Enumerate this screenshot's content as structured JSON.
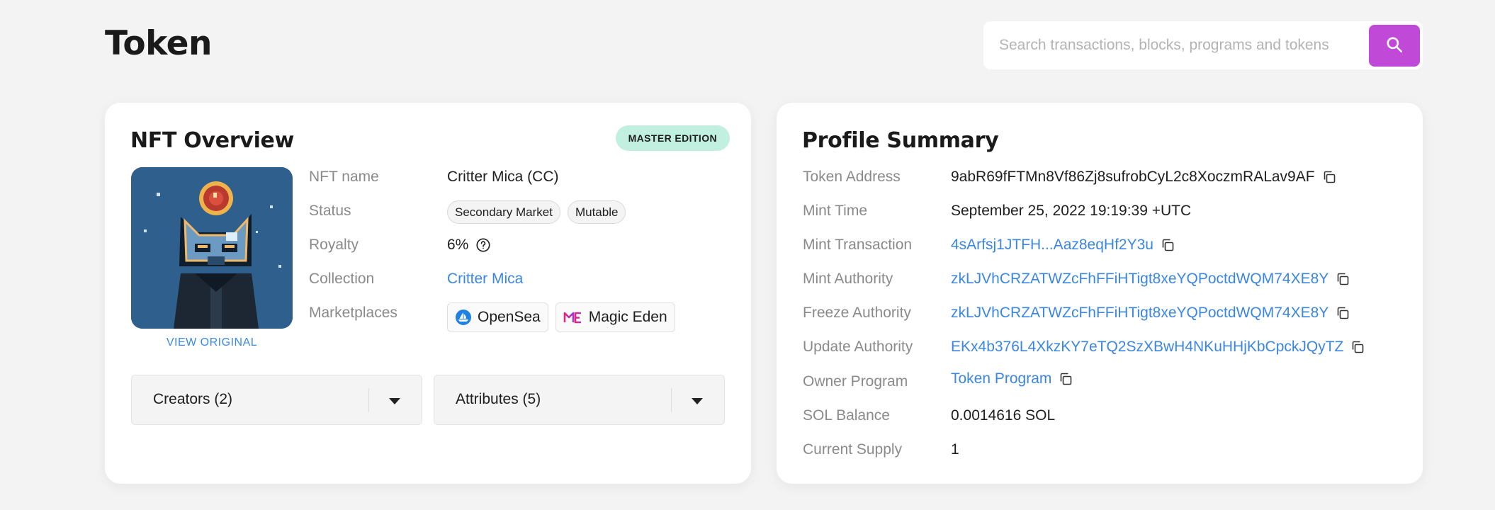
{
  "header": {
    "title": "Token",
    "search_placeholder": "Search transactions, blocks, programs and tokens"
  },
  "nft_overview": {
    "heading": "NFT Overview",
    "badge": "MASTER EDITION",
    "view_original": "VIEW ORIGINAL",
    "fields": {
      "name_label": "NFT name",
      "name_value": "Critter Mica (CC)",
      "status_label": "Status",
      "status_chips": [
        "Secondary Market",
        "Mutable"
      ],
      "royalty_label": "Royalty",
      "royalty_value": "6%",
      "collection_label": "Collection",
      "collection_value": "Critter Mica",
      "marketplaces_label": "Marketplaces",
      "marketplaces": [
        "OpenSea",
        "Magic Eden"
      ]
    },
    "accordions": [
      "Creators (2)",
      "Attributes (5)"
    ]
  },
  "profile_summary": {
    "heading": "Profile Summary",
    "rows": [
      {
        "label": "Token Address",
        "value": "9abR69fFTMn8Vf86Zj8sufrobCyL2c8XoczmRALav9AF"
      },
      {
        "label": "Mint Time",
        "value": "September 25, 2022 19:19:39 +UTC"
      },
      {
        "label": "Mint Transaction",
        "value": "4sArfsj1JTFH...Aaz8eqHf2Y3u"
      },
      {
        "label": "Mint Authority",
        "value": "zkLJVhCRZATWZcFhFFiHTigt8xeYQPoctdWQM74XE8Y"
      },
      {
        "label": "Freeze Authority",
        "value": "zkLJVhCRZATWZcFhFFiHTigt8xeYQPoctdWQM74XE8Y"
      },
      {
        "label": "Update Authority",
        "value": "EKx4b376L4XkzKY7eTQ2SzXBwH4NKuHHjKbCpckJQyTZ"
      },
      {
        "label": "Owner Program",
        "value": "Token Program"
      },
      {
        "label": "SOL Balance",
        "value": "0.0014616 SOL"
      },
      {
        "label": "Current Supply",
        "value": "1"
      }
    ]
  },
  "colors": {
    "accent_purple": "#c149d8",
    "link_blue": "#3a86e0",
    "badge_green": "#c2f0e0"
  }
}
